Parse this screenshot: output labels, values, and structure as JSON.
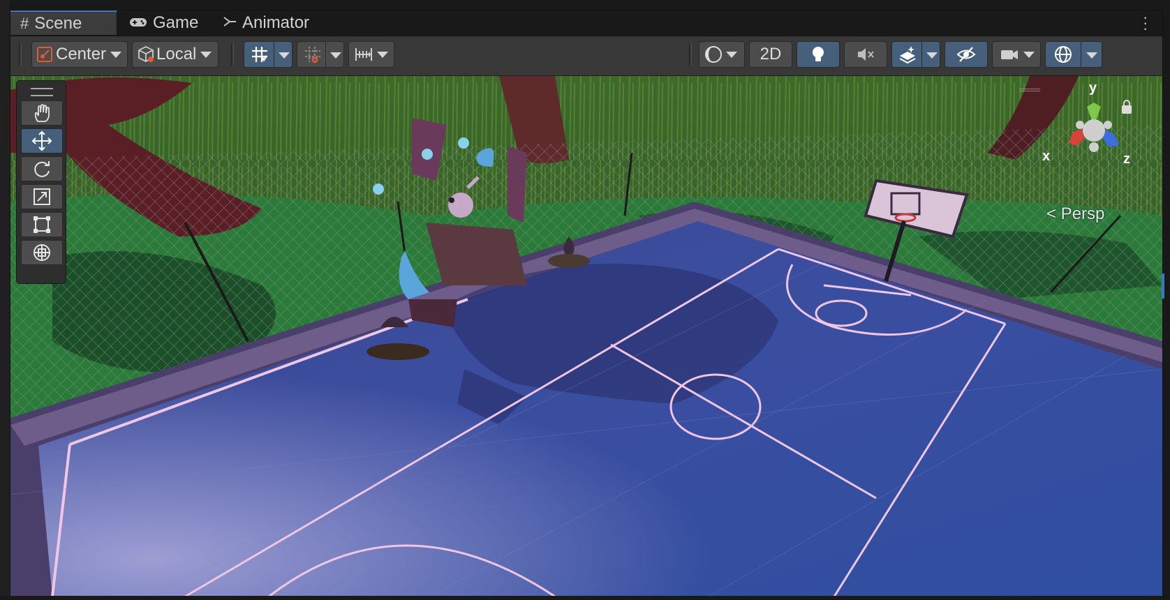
{
  "tabs": [
    {
      "label": "Scene",
      "icon": "hash-icon",
      "active": true
    },
    {
      "label": "Game",
      "icon": "gamepad-icon",
      "active": false
    },
    {
      "label": "Animator",
      "icon": "animator-icon",
      "active": false
    }
  ],
  "toolbar": {
    "pivot_label": "Center",
    "space_label": "Local",
    "twod_label": "2D"
  },
  "overlay": {
    "projection_label": "< Persp",
    "axis_x": "x",
    "axis_y": "y",
    "axis_z": "z"
  },
  "colors": {
    "accent": "#46607c",
    "court": "#3d4f9a",
    "grass": "#2f7a3a",
    "axis_x": "#d9443a",
    "axis_y": "#7ec84a",
    "axis_z": "#3d6ee0"
  }
}
